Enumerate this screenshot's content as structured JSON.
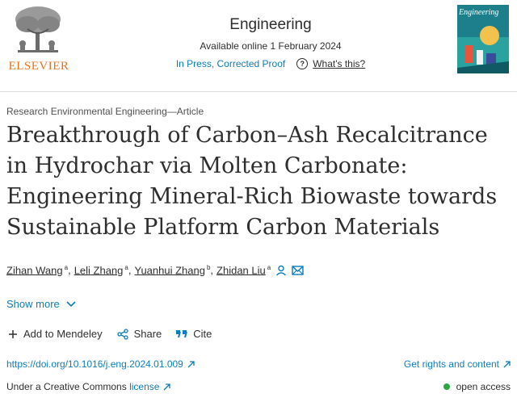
{
  "publisher": {
    "name": "ELSEVIER"
  },
  "journal": {
    "name": "Engineering",
    "available": "Available online 1 February 2024",
    "status": "In Press, Corrected Proof",
    "whats_this": "What's this?",
    "cover_title": "Engineering"
  },
  "article": {
    "section": "Research Environmental Engineering—Article",
    "title": "Breakthrough of Carbon–Ash Recalcitrance in Hydrochar via Molten Carbonate: Engineering Mineral-Rich Biowaste towards Sustainable Platform Carbon Materials",
    "authors": [
      {
        "name": "Zihan Wang",
        "aff": "a",
        "sep": ","
      },
      {
        "name": "Leli Zhang",
        "aff": "a",
        "sep": ","
      },
      {
        "name": "Yuanhui Zhang",
        "aff": "b",
        "sep": ","
      },
      {
        "name": "Zhidan Liu",
        "aff": "a",
        "sep": ""
      }
    ],
    "show_more": "Show more",
    "actions": {
      "mendeley": "Add to Mendeley",
      "share": "Share",
      "cite": "Cite"
    },
    "doi": "https://doi.org/10.1016/j.eng.2024.01.009",
    "rights": "Get rights and content",
    "license_text": "Under a Creative Commons",
    "license_link": "license",
    "open_access": "open access"
  },
  "colors": {
    "link": "#0c7dbb",
    "publisher_orange": "#e9711c",
    "open_access_dot": "#29a745",
    "text": "#2e2e2e"
  }
}
